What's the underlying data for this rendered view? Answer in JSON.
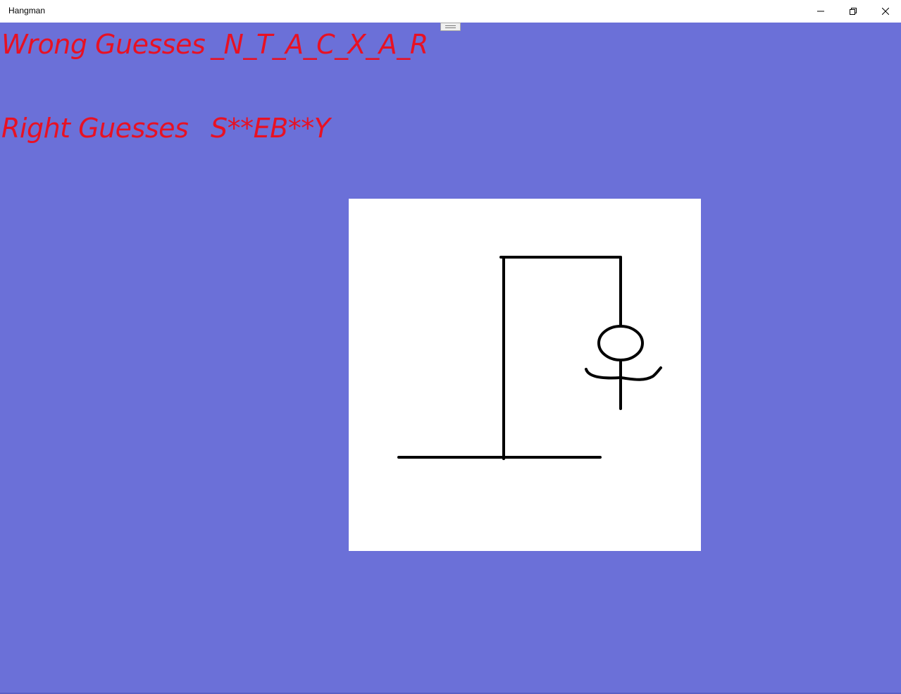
{
  "window": {
    "title": "Hangman",
    "buttons": {
      "minimize_icon": "minimize-icon",
      "maximize_icon": "restore-icon",
      "close_icon": "close-icon"
    }
  },
  "game": {
    "wrong_label": "Wrong Guesses",
    "wrong_value": "_N_T_A_C_X_A_R",
    "right_label": "Right Guesses",
    "right_value": "S**EB**Y"
  },
  "colors": {
    "background": "#6b70d8",
    "text": "#e81123",
    "canvas": "#ffffff",
    "stroke": "#000000"
  }
}
